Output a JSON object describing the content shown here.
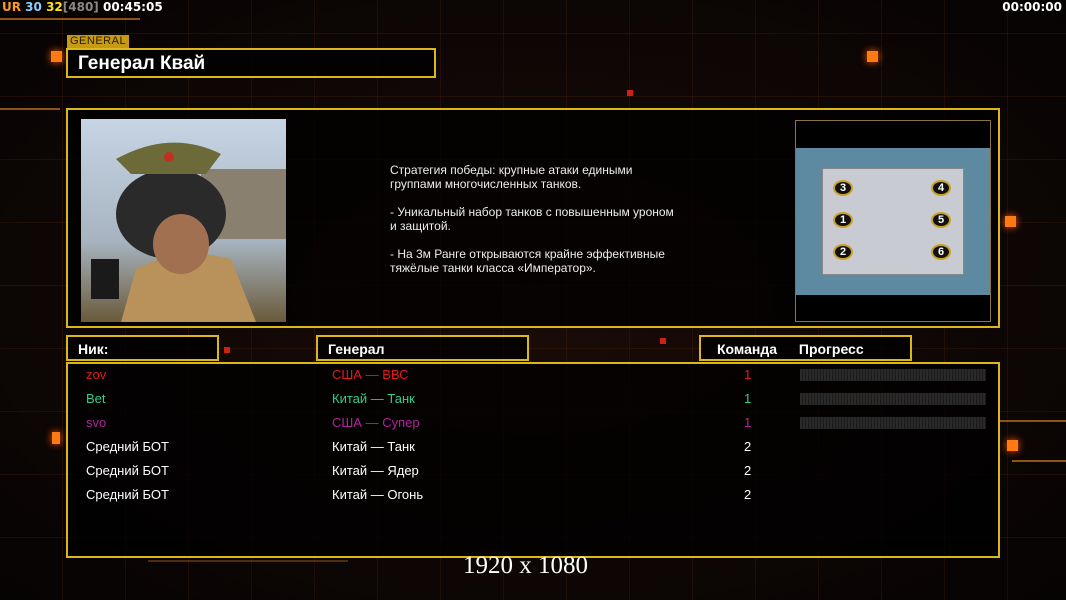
{
  "hud": {
    "ur": "UR",
    "n1": "30",
    "n2": "32",
    "n3": "[480]",
    "time": "00:45:05",
    "right_time": "00:00:00"
  },
  "general": {
    "tag": "GENERAL",
    "name": "Генерал Квай",
    "description": "Стратегия победы: крупные атаки едиными\n группами многочисленных танков.\n\n- Уникальный набор танков с повышенным уроном\n и защитой.\n\n- На 3м Ранге открываются крайне эффективные\n тяжёлые танки класса «Император»."
  },
  "map": {
    "slots": [
      "3",
      "4",
      "1",
      "5",
      "2",
      "6"
    ]
  },
  "headers": {
    "nick": "Ник:",
    "general": "Генерал",
    "team": "Команда",
    "progress": "Прогресс"
  },
  "players": [
    {
      "nick": "zov",
      "general": "США — ВВС",
      "team": "1",
      "color": "#e21a1a",
      "progress": 0
    },
    {
      "nick": "Bet",
      "general": "Китай — Танк",
      "team": "1",
      "color": "#2ed08a",
      "progress": 0
    },
    {
      "nick": "svo",
      "general": "США — Супер",
      "team": "1",
      "color": "#b3219c",
      "progress": 0
    },
    {
      "nick": "Средний БОТ",
      "general": "Китай — Танк",
      "team": "2",
      "color": "#ffffff"
    },
    {
      "nick": "Средний БОТ",
      "general": "Китай — Ядер",
      "team": "2",
      "color": "#ffffff"
    },
    {
      "nick": "Средний БОТ",
      "general": "Китай — Огонь",
      "team": "2",
      "color": "#ffffff"
    }
  ],
  "resolution": "1920 x 1080"
}
